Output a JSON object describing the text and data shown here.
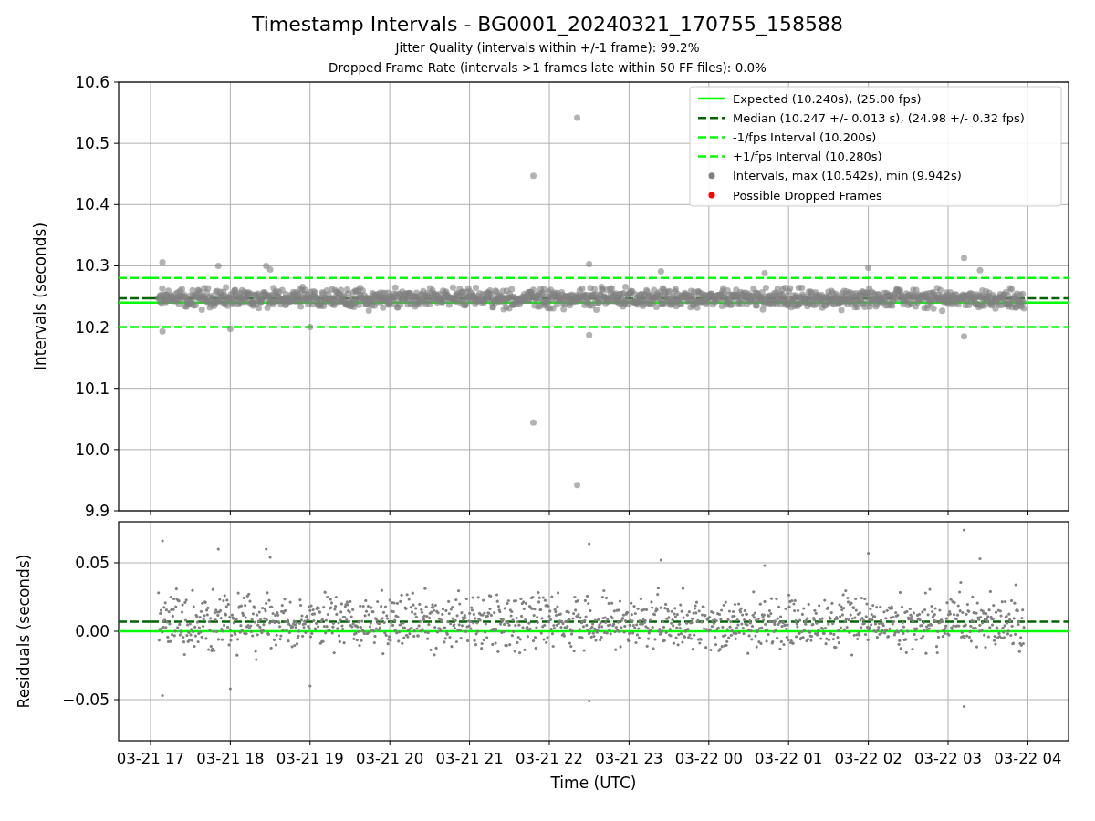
{
  "figure": {
    "title": "Timestamp Intervals - BG0001_20240321_170755_158588",
    "subtitles": [
      "Jitter Quality (intervals within +/-1 frame): 99.2%",
      "Dropped Frame Rate (intervals >1 frames late within 50 FF files): 0.0%"
    ]
  },
  "charts": [
    {
      "chart_data": {
        "type": "line",
        "ylabel": "Intervals (seconds)",
        "categories": [
          null,
          null,
          null,
          null,
          null,
          null,
          null,
          null,
          null,
          null,
          null,
          null
        ],
        "ylim": [
          9.9,
          10.6
        ],
        "yticks": [
          {
            "value": 9.9,
            "label": "9.9"
          },
          {
            "value": 10.0,
            "label": "10.0"
          },
          {
            "value": 10.1,
            "label": "10.1"
          },
          {
            "value": 10.2,
            "label": "10.2"
          },
          {
            "value": 10.3,
            "label": "10.3"
          },
          {
            "value": 10.4,
            "label": "10.4"
          },
          {
            "value": 10.5,
            "label": "10.5"
          },
          {
            "value": 10.6,
            "label": "10.6"
          }
        ],
        "series": [
          {
            "name": "Expected (10.240s), (25.00 fps)",
            "color": "#00ff00",
            "line_style": "solid",
            "marker": "none",
            "values": [
              10.24,
              10.24,
              10.24,
              10.24,
              10.24,
              10.24,
              10.24,
              10.24,
              10.24,
              10.24,
              10.24,
              10.24
            ]
          },
          {
            "name": "Median (10.247 +/- 0.013 s), (24.98 +/- 0.32 fps)",
            "color": "#006400",
            "line_style": "dashed",
            "marker": "none",
            "values": [
              10.247,
              10.247,
              10.247,
              10.247,
              10.247,
              10.247,
              10.247,
              10.247,
              10.247,
              10.247,
              10.247,
              10.247
            ]
          },
          {
            "name": "-1/fps Interval (10.200s)",
            "color": "#00ff00",
            "line_style": "dashed",
            "marker": "none",
            "values": [
              10.2,
              10.2,
              10.2,
              10.2,
              10.2,
              10.2,
              10.2,
              10.2,
              10.2,
              10.2,
              10.2,
              10.2
            ]
          },
          {
            "name": "+1/fps Interval (10.280s)",
            "color": "#00ff00",
            "line_style": "dashed",
            "marker": "none",
            "values": [
              10.28,
              10.28,
              10.28,
              10.28,
              10.28,
              10.28,
              10.28,
              10.28,
              10.28,
              10.28,
              10.28,
              10.28
            ]
          }
        ],
        "grid": true,
        "legend": true
      },
      "legend_points": [
        {
          "label": "Intervals, max (10.542s), min (9.942s)",
          "color": "#808080"
        },
        {
          "label": "Possible Dropped Frames",
          "color": "#ff0000"
        }
      ]
    },
    {
      "chart_data": {
        "type": "line",
        "xlabel": "Time (UTC)",
        "ylabel": "Residuals (seconds)",
        "categories": [
          "03-21 17",
          "03-21 18",
          "03-21 19",
          "03-21 20",
          "03-21 21",
          "03-21 22",
          "03-21 23",
          "03-22 00",
          "03-22 01",
          "03-22 02",
          "03-22 03",
          "03-22 04"
        ],
        "ylim": [
          -0.08,
          0.08
        ],
        "yticks": [
          {
            "value": -0.05,
            "label": "−0.05"
          },
          {
            "value": 0,
            "label": "0.00"
          },
          {
            "value": 0.05,
            "label": "0.05"
          }
        ],
        "series": [
          {
            "color": "#00ff00",
            "line_style": "solid",
            "marker": "none",
            "values": [
              0,
              0,
              0,
              0,
              0,
              0,
              0,
              0,
              0,
              0,
              0,
              0
            ]
          },
          {
            "color": "#006400",
            "line_style": "dashed",
            "marker": "none",
            "values": [
              0.007,
              0.007,
              0.007,
              0.007,
              0.007,
              0.007,
              0.007,
              0.007,
              0.007,
              0.007,
              0.007,
              0.007
            ]
          }
        ],
        "grid": true
      }
    }
  ]
}
